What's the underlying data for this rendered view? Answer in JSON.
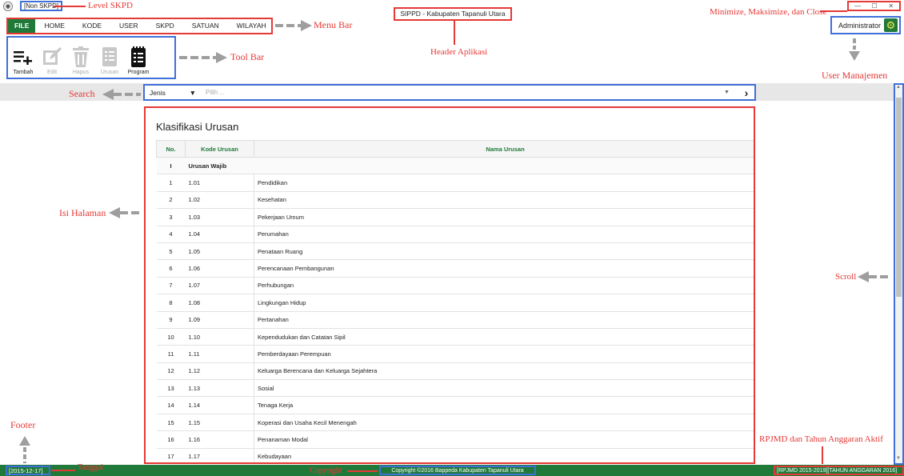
{
  "window": {
    "level": "[Non SKPD]",
    "header": "SIPPD - Kabupaten Tapanuli Utara",
    "controls": [
      "—",
      "☐",
      "✕"
    ]
  },
  "menu": {
    "file": "FILE",
    "items": [
      "HOME",
      "KODE",
      "USER",
      "SKPD",
      "SATUAN",
      "WILAYAH"
    ]
  },
  "user": {
    "name": "Administrator",
    "icon": "gear-icon"
  },
  "toolbar": {
    "buttons": [
      {
        "label": "Tambah",
        "icon": "add-list-icon",
        "enabled": true
      },
      {
        "label": "Edit",
        "icon": "edit-icon",
        "enabled": false
      },
      {
        "label": "Hapus",
        "icon": "trash-icon",
        "enabled": false
      },
      {
        "label": "Urusan",
        "icon": "list-icon",
        "enabled": false
      },
      {
        "label": "Program",
        "icon": "notebook-icon",
        "enabled": true
      }
    ]
  },
  "search": {
    "type": "Jenis",
    "placeholder": "Pilih ..."
  },
  "content": {
    "title": "Klasifikasi Urusan",
    "columns": [
      "No.",
      "Kode Urusan",
      "Nama Urusan"
    ],
    "group": {
      "no": "I",
      "label": "Urusan Wajib"
    },
    "rows": [
      {
        "no": "1",
        "kode": "1.01",
        "nama": "Pendidikan"
      },
      {
        "no": "2",
        "kode": "1.02",
        "nama": "Kesehatan"
      },
      {
        "no": "3",
        "kode": "1.03",
        "nama": "Pekerjaan Umum"
      },
      {
        "no": "4",
        "kode": "1.04",
        "nama": "Perumahan"
      },
      {
        "no": "5",
        "kode": "1.05",
        "nama": "Penataan Ruang"
      },
      {
        "no": "6",
        "kode": "1.06",
        "nama": "Perencanaan Pembangunan"
      },
      {
        "no": "7",
        "kode": "1.07",
        "nama": "Perhubungan"
      },
      {
        "no": "8",
        "kode": "1.08",
        "nama": "Lingkungan Hidup"
      },
      {
        "no": "9",
        "kode": "1.09",
        "nama": "Pertanahan"
      },
      {
        "no": "10",
        "kode": "1.10",
        "nama": "Kependudukan dan Catatan Sipil"
      },
      {
        "no": "11",
        "kode": "1.11",
        "nama": "Pemberdayaan Perempuan"
      },
      {
        "no": "12",
        "kode": "1.12",
        "nama": "Keluarga Berencana dan Keluarga Sejahtera"
      },
      {
        "no": "13",
        "kode": "1.13",
        "nama": "Sosial"
      },
      {
        "no": "14",
        "kode": "1.14",
        "nama": "Tenaga Kerja"
      },
      {
        "no": "15",
        "kode": "1.15",
        "nama": "Koperasi dan Usaha Kecil Menengah"
      },
      {
        "no": "16",
        "kode": "1.16",
        "nama": "Penanaman Modal"
      },
      {
        "no": "17",
        "kode": "1.17",
        "nama": "Kebudayaan"
      }
    ]
  },
  "footer": {
    "date": "[2015-12-17]",
    "copyright": "Copyright ©2016 Bappeda Kabupaten Tapanuli Utara",
    "rpjmd": "[RPJMD 2015-2019][TAHUN ANGGARAN 2016]"
  },
  "annotations": {
    "level": "Level SKPD",
    "menu": "Menu Bar",
    "header": "Header Aplikasi",
    "window": "Minimize, Maksimize, dan Close",
    "toolbar": "Tool Bar",
    "user": "User Manajemen",
    "search": "Search",
    "content": "Isi Halaman",
    "scroll": "Scroll",
    "footer": "Footer",
    "date": "Tanggal",
    "copyright": "Copyright",
    "rpjmd": "RPJMD dan Tahun Anggaran Aktif"
  },
  "colors": {
    "accent": "#1f7a3a",
    "annotation": "#e53935",
    "highlight": "#3f6fd8"
  }
}
